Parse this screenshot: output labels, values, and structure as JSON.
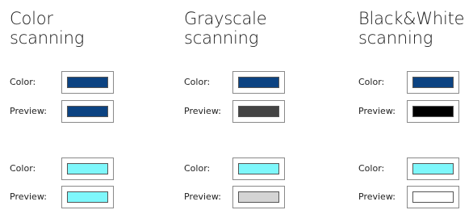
{
  "columns": [
    {
      "title_line1": "Color",
      "title_line2": "scanning",
      "groups": [
        {
          "color_label": "Color:",
          "color_value": "#0c4382",
          "preview_label": "Preview:",
          "preview_value": "#0c4382"
        },
        {
          "color_label": "Color:",
          "color_value": "#7ef7fb",
          "preview_label": "Preview:",
          "preview_value": "#7ef7fb"
        }
      ]
    },
    {
      "title_line1": "Grayscale",
      "title_line2": "scanning",
      "groups": [
        {
          "color_label": "Color:",
          "color_value": "#0c4382",
          "preview_label": "Preview:",
          "preview_value": "#444444"
        },
        {
          "color_label": "Color:",
          "color_value": "#7ef7fb",
          "preview_label": "Preview:",
          "preview_value": "#d4d4d4"
        }
      ]
    },
    {
      "title_line1": "Black&White",
      "title_line2": "scanning",
      "groups": [
        {
          "color_label": "Color:",
          "color_value": "#0c4382",
          "preview_label": "Preview:",
          "preview_value": "#000000"
        },
        {
          "color_label": "Color:",
          "color_value": "#7ef7fb",
          "preview_label": "Preview:",
          "preview_value": "#ffffff"
        }
      ]
    }
  ]
}
